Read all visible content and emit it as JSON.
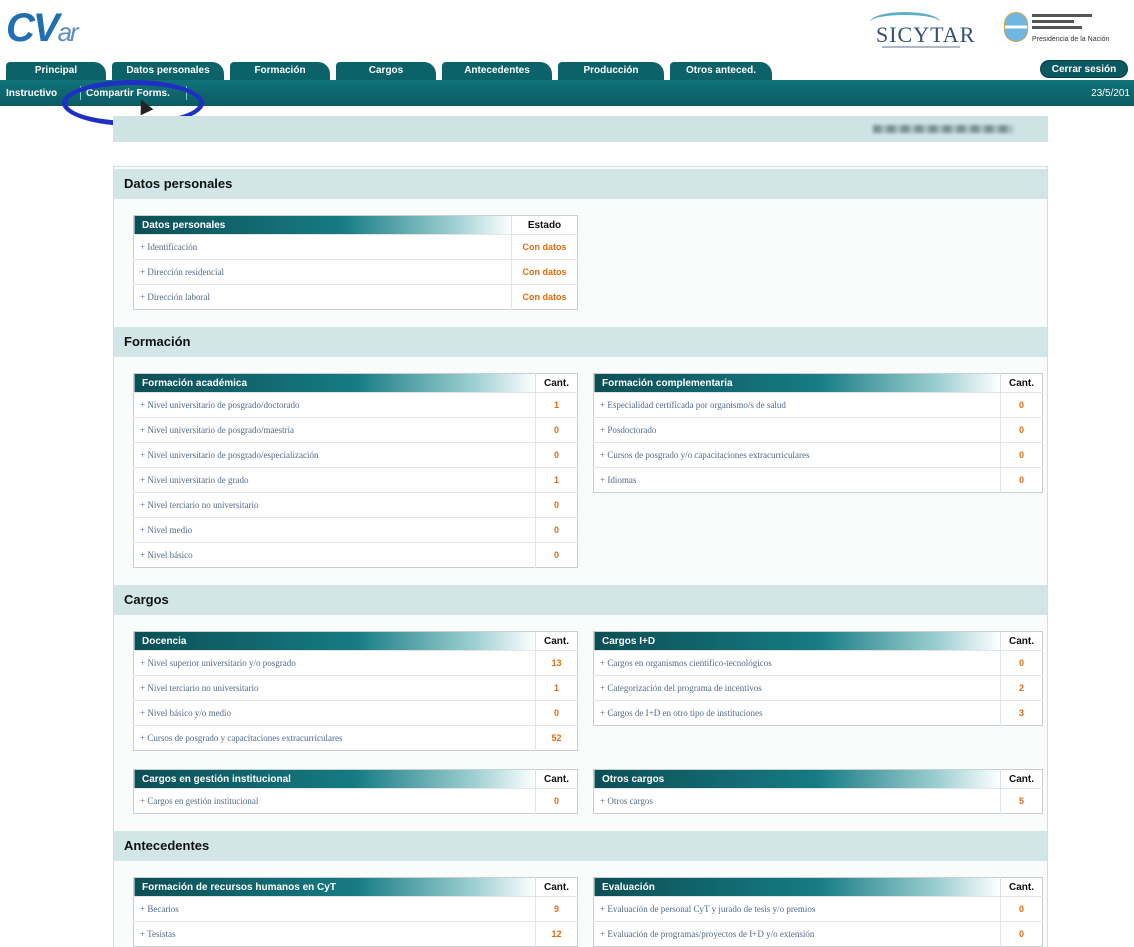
{
  "header": {
    "logo_main": "CV",
    "logo_sub": "ar",
    "sicytar": "SICYTAR",
    "presidencia": "Presidencia de la Nación"
  },
  "tabs": [
    "Principal",
    "Datos personales",
    "Formación",
    "Cargos",
    "Antecedentes",
    "Producción",
    "Otros anteced."
  ],
  "logout_label": "Cerrar sesión",
  "subnav": {
    "instructivo": "Instructivo",
    "compartir": "Compartir Forms.",
    "date": "23/5/201"
  },
  "sections": {
    "datos": "Datos personales",
    "formacion": "Formación",
    "cargos": "Cargos",
    "antecedentes": "Antecedentes"
  },
  "datos_table": {
    "title": "Datos personales",
    "col": "Estado",
    "rows": [
      {
        "label": "+ Identificación",
        "value": "Con datos"
      },
      {
        "label": "+ Dirección residencial",
        "value": "Con datos"
      },
      {
        "label": "+ Dirección laboral",
        "value": "Con datos"
      }
    ]
  },
  "academica": {
    "title": "Formación académica",
    "col": "Cant.",
    "rows": [
      {
        "label": "+ Nivel universitario de posgrado/doctorado",
        "value": "1"
      },
      {
        "label": "+ Nivel universitario de posgrado/maestría",
        "value": "0"
      },
      {
        "label": "+ Nivel universitario de posgrado/especialización",
        "value": "0"
      },
      {
        "label": "+ Nivel universitario de grado",
        "value": "1"
      },
      {
        "label": "+ Nivel terciario no universitario",
        "value": "0"
      },
      {
        "label": "+ Nivel medio",
        "value": "0"
      },
      {
        "label": "+ Nivel básico",
        "value": "0"
      }
    ]
  },
  "complementaria": {
    "title": "Formación complementaria",
    "col": "Cant.",
    "rows": [
      {
        "label": "+ Especialidad certificada por organismo/s de salud",
        "value": "0"
      },
      {
        "label": "+ Posdoctorado",
        "value": "0"
      },
      {
        "label": "+ Cursos de posgrado y/o capacitaciones extracurriculares",
        "value": "0"
      },
      {
        "label": "+ Idiomas",
        "value": "0"
      }
    ]
  },
  "docencia": {
    "title": "Docencia",
    "col": "Cant.",
    "rows": [
      {
        "label": "+ Nivel superior universitario y/o posgrado",
        "value": "13"
      },
      {
        "label": "+ Nivel terciario no universitario",
        "value": "1"
      },
      {
        "label": "+ Nivel básico y/o medio",
        "value": "0"
      },
      {
        "label": "+ Cursos de posgrado y capacitaciones extracurriculares",
        "value": "52"
      }
    ]
  },
  "cargos_id": {
    "title": "Cargos I+D",
    "col": "Cant.",
    "rows": [
      {
        "label": "+ Cargos en organismos científico-tecnológicos",
        "value": "0"
      },
      {
        "label": "+ Categorización del programa de incentivos",
        "value": "2"
      },
      {
        "label": "+ Cargos de I+D en otro tipo de instituciones",
        "value": "3"
      }
    ]
  },
  "gestion": {
    "title": "Cargos en gestión institucional",
    "col": "Cant.",
    "rows": [
      {
        "label": "+ Cargos en gestión institucional",
        "value": "0"
      }
    ]
  },
  "otros": {
    "title": "Otros cargos",
    "col": "Cant.",
    "rows": [
      {
        "label": "+ Otros cargos",
        "value": "5"
      }
    ]
  },
  "rrhh": {
    "title": "Formación de recursos humanos en CyT",
    "col": "Cant.",
    "rows": [
      {
        "label": "+ Becarios",
        "value": "9"
      },
      {
        "label": "+ Tesistas",
        "value": "12"
      }
    ]
  },
  "evaluacion": {
    "title": "Evaluación",
    "col": "Cant.",
    "rows": [
      {
        "label": "+ Evaluación de personal CyT y jurado de tesis y/o premios",
        "value": "0"
      },
      {
        "label": "+ Evaluación de programas/proyectos de I+D y/o extensión",
        "value": "0"
      }
    ]
  }
}
